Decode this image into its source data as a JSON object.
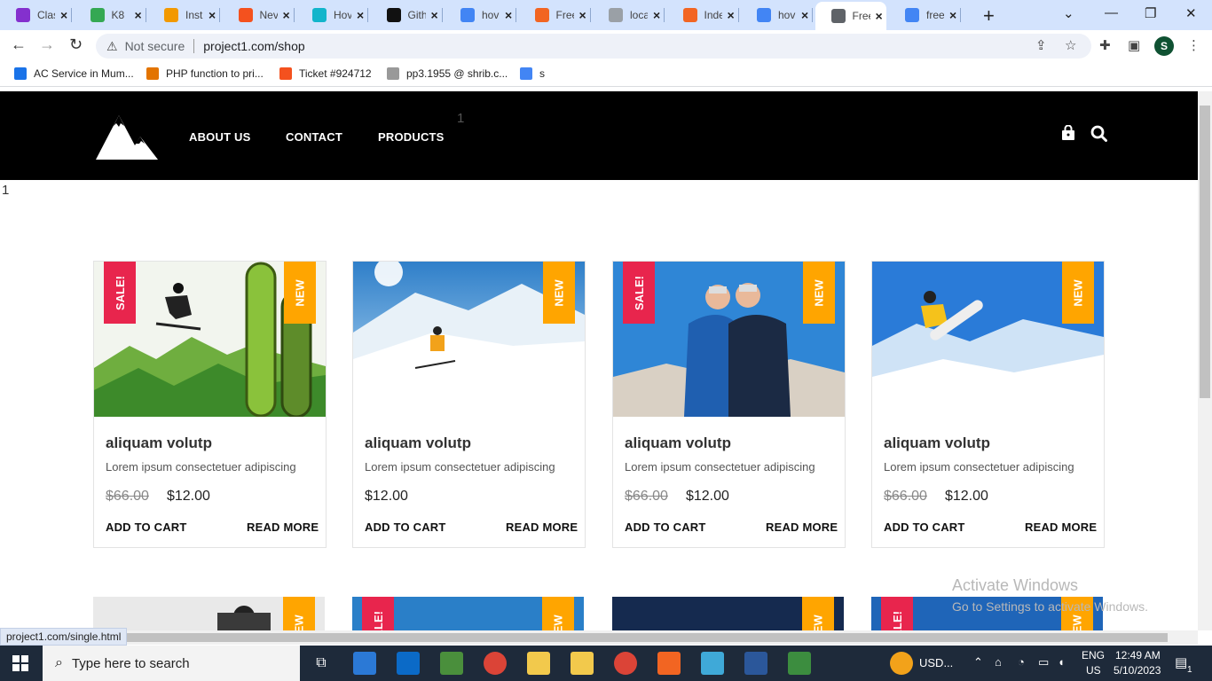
{
  "browser": {
    "tabs": [
      {
        "title": "Clas",
        "color": "#8430ce"
      },
      {
        "title": "K8",
        "color": "#34a853"
      },
      {
        "title": "Inst",
        "color": "#f29900"
      },
      {
        "title": "Nev",
        "color": "#f4511e"
      },
      {
        "title": "Hov",
        "color": "#12b5cb"
      },
      {
        "title": "Gith",
        "color": "#111111"
      },
      {
        "title": "hov",
        "color": "#4285f4"
      },
      {
        "title": "Free",
        "color": "#f26522"
      },
      {
        "title": "loca",
        "color": "#9aa0a6"
      },
      {
        "title": "Inde",
        "color": "#f26522"
      },
      {
        "title": "hov",
        "color": "#4285f4"
      },
      {
        "title": "Free",
        "color": "#5f6368",
        "active": true
      },
      {
        "title": "free",
        "color": "#4285f4"
      }
    ],
    "security_label": "Not secure",
    "url": "project1.com/shop",
    "profile_initial": "S",
    "bookmarks": [
      {
        "label": "AC Service in Mum...",
        "color": "#1a73e8"
      },
      {
        "label": "PHP function to pri...",
        "color": "#e37400"
      },
      {
        "label": "Ticket #924712",
        "color": "#f4511e"
      },
      {
        "label": "pp3.1955 @ shrib.c...",
        "color": "#999999"
      },
      {
        "label": "s",
        "color": "#4285f4"
      }
    ],
    "status_url": "project1.com/single.html"
  },
  "site": {
    "nav": [
      "ABOUT US",
      "CONTACT",
      "PRODUCTS"
    ],
    "stray_text_header": "1",
    "stray_text_body": "1",
    "products": [
      {
        "title": "aliquam volutp",
        "desc": "Lorem ipsum consectetuer adipiscing",
        "old_price": "$66.00",
        "price": "$12.00",
        "sale": "SALE!",
        "new": "NEW",
        "add": "ADD TO CART",
        "more": "READ MORE"
      },
      {
        "title": "aliquam volutp",
        "desc": "Lorem ipsum consectetuer adipiscing",
        "old_price": "",
        "price": "$12.00",
        "sale": "",
        "new": "NEW",
        "add": "ADD TO CART",
        "more": "READ MORE"
      },
      {
        "title": "aliquam volutp",
        "desc": "Lorem ipsum consectetuer adipiscing",
        "old_price": "$66.00",
        "price": "$12.00",
        "sale": "SALE!",
        "new": "NEW",
        "add": "ADD TO CART",
        "more": "READ MORE"
      },
      {
        "title": "aliquam volutp",
        "desc": "Lorem ipsum consectetuer adipiscing",
        "old_price": "$66.00",
        "price": "$12.00",
        "sale": "",
        "new": "NEW",
        "add": "ADD TO CART",
        "more": "READ MORE"
      }
    ],
    "second_row": [
      {
        "sale": "",
        "new": "NEW"
      },
      {
        "sale": "SALE!",
        "new": "NEW"
      },
      {
        "sale": "",
        "new": "NEW"
      },
      {
        "sale": "SALE!",
        "new": "NEW"
      }
    ]
  },
  "watermark": {
    "line1": "Activate Windows",
    "line2": "Go to Settings to activate Windows."
  },
  "taskbar": {
    "search_placeholder": "Type here to search",
    "currency": "USD...",
    "lang1": "ENG",
    "lang2": "US",
    "time": "12:49 AM",
    "date": "5/10/2023",
    "notifications": "1"
  }
}
